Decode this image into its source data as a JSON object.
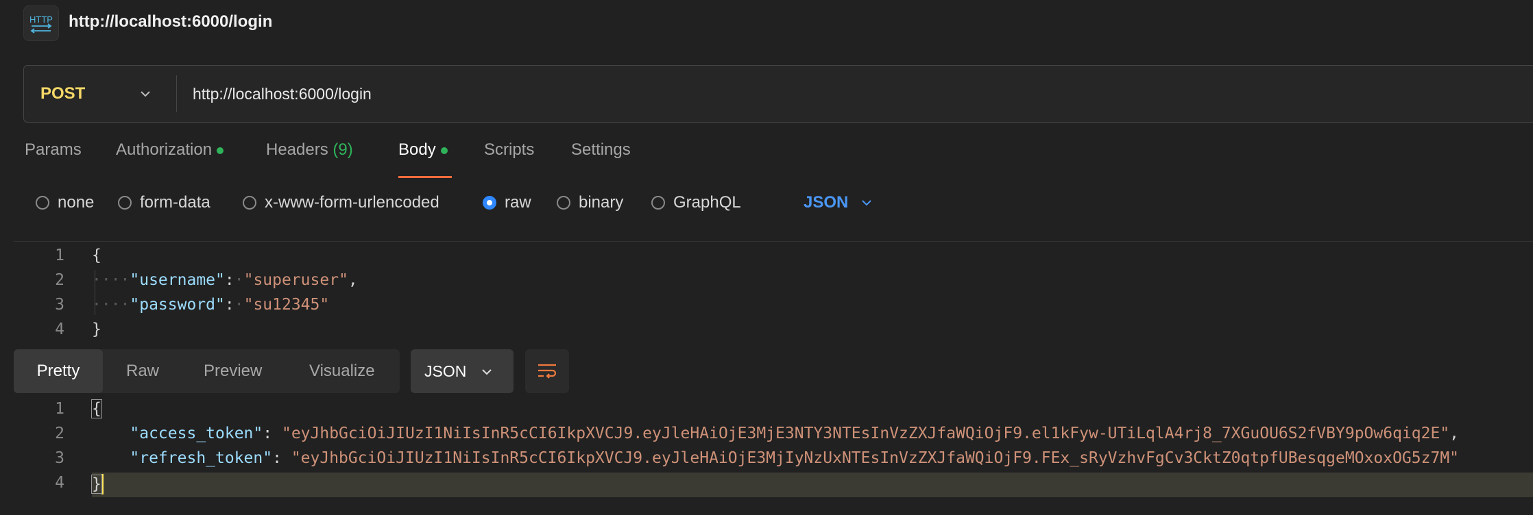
{
  "header": {
    "title": "http://localhost:6000/login",
    "icon": "http-icon",
    "icon_text": "HTTP"
  },
  "request": {
    "method": "POST",
    "url": "http://localhost:6000/login"
  },
  "tabs": {
    "params": "Params",
    "authorization": "Authorization",
    "headers": "Headers",
    "headers_count": "(9)",
    "body": "Body",
    "scripts": "Scripts",
    "settings": "Settings",
    "active": "Body"
  },
  "body_types": {
    "none": "none",
    "form_data": "form-data",
    "urlencoded": "x-www-form-urlencoded",
    "raw": "raw",
    "binary": "binary",
    "graphql": "GraphQL",
    "selected": "raw",
    "raw_language": "JSON"
  },
  "request_body": {
    "line_numbers": [
      "1",
      "2",
      "3",
      "4"
    ],
    "open_brace": "{",
    "close_brace": "}",
    "username_key": "\"username\"",
    "username_value": "\"superuser\"",
    "password_key": "\"password\"",
    "password_value": "\"su12345\""
  },
  "response_toolbar": {
    "pretty": "Pretty",
    "raw": "Raw",
    "preview": "Preview",
    "visualize": "Visualize",
    "active": "Pretty",
    "format": "JSON"
  },
  "response_body": {
    "line_numbers": [
      "1",
      "2",
      "3",
      "4"
    ],
    "open_brace": "{",
    "close_brace": "}",
    "access_token_key": "\"access_token\"",
    "access_token_value": "\"eyJhbGciOiJIUzI1NiIsInR5cCI6IkpXVCJ9.eyJleHAiOjE3MjE3NTY3NTEsInVzZXJfaWQiOjF9.el1kFyw-UTiLqlA4rj8_7XGuOU6S2fVBY9pOw6qiq2E\"",
    "refresh_token_key": "\"refresh_token\"",
    "refresh_token_value": "\"eyJhbGciOiJIUzI1NiIsInR5cCI6IkpXVCJ9.eyJleHAiOjE3MjIyNzUxNTEsInVzZXJfaWQiOjF9.FEx_sRyVzhvFgCv3CktZ0qtpfUBesqgeMOxoxOG5z7M\""
  },
  "colors": {
    "method": "#f5d867",
    "active_tab_underline": "#f26b3a",
    "status_dot": "#2fb35a",
    "radio_selected": "#2f88ff",
    "json_link": "#4a97f5",
    "json_key": "#9cdcfe",
    "json_string": "#ce9178"
  }
}
